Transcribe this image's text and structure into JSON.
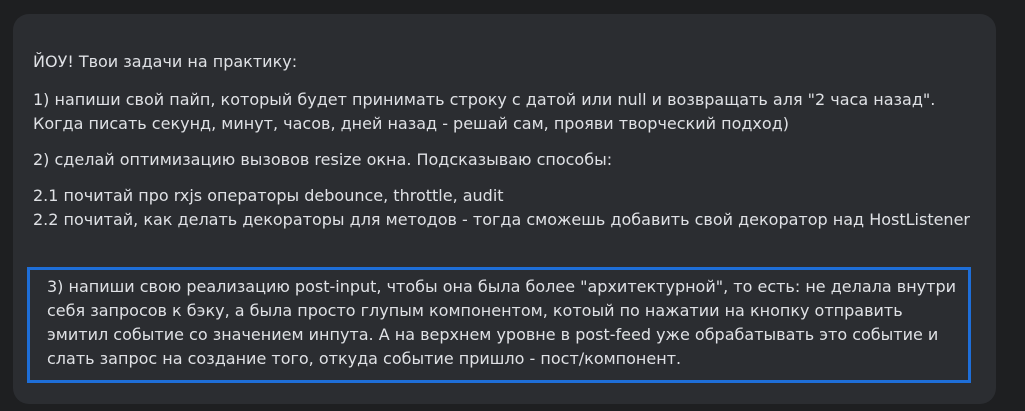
{
  "message": {
    "title": "ЙОУ! Твои задачи на практику:",
    "tasks": [
      "1) напиши свой пайп, который будет принимать строку с датой или null и возвращать аля \"2 часа назад\". Когда писать секунд, минут, часов, дней назад - решай сам, прояви творческий подход)",
      "2) сделай оптимизацию вызовов resize окна. Подсказываю способы:",
      "2.1 почитай про rxjs операторы debounce, throttle, audit",
      "2.2 почитай, как делать декораторы для методов - тогда сможешь добавить свой декоратор над HostListener",
      "3) напиши свою реализацию post-input, чтобы она была более \"архитектурной\", то есть: не делала внутри себя запросов к бэку, а была просто глупым компонентом, котоый по нажатии на кнопку отправить эмитил событие со значением инпута. А на верхнем уровне в post-feed уже обрабатывать это событие и слать запрос на создание того, откуда событие пришло - пост/компонент."
    ]
  },
  "colors": {
    "page_background": "#1e1f21",
    "bubble_background": "#2b2d31",
    "text": "#dfe1e5",
    "selection_border": "#1e6ed8"
  }
}
